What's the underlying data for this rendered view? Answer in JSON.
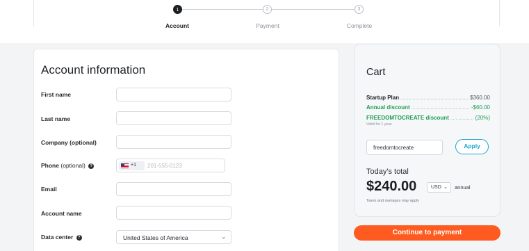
{
  "stepper": {
    "steps": [
      {
        "number": "1",
        "label": "Account",
        "state": "active"
      },
      {
        "number": "2",
        "label": "Payment",
        "state": "inactive"
      },
      {
        "number": "3",
        "label": "Complete",
        "state": "inactive"
      }
    ]
  },
  "form": {
    "title": "Account information",
    "fields": {
      "first_name": {
        "label": "First name",
        "value": ""
      },
      "last_name": {
        "label": "Last name",
        "value": ""
      },
      "company": {
        "label": "Company (optional)",
        "value": ""
      },
      "phone": {
        "label": "Phone",
        "optional": "(optional)",
        "country_code": "+1",
        "placeholder": "201-555-0123",
        "flag": "us-flag-icon"
      },
      "email": {
        "label": "Email",
        "value": ""
      },
      "account_name": {
        "label": "Account name",
        "value": ""
      },
      "data_center": {
        "label": "Data center",
        "value": "United States of America"
      }
    }
  },
  "cart": {
    "title": "Cart",
    "lines": [
      {
        "name": "Startup Plan",
        "amount": "$360.00",
        "kind": "plan"
      },
      {
        "name": "Annual discount",
        "amount": "-$60.00",
        "kind": "discount"
      },
      {
        "name": "FREEDOMTOCREATE discount",
        "amount": "(20%)",
        "kind": "discount"
      }
    ],
    "valid_note": "Valid for 1 year",
    "promo_code": "freedomtocreate",
    "apply_label": "Apply",
    "today_label": "Today's total",
    "total": "$240.00",
    "currency": "USD",
    "period": "annual",
    "tax_note": "Taxes and overages may apply"
  },
  "continue_label": "Continue to payment",
  "colors": {
    "accent_orange": "#ff5a1f",
    "discount_green": "#1f9d55",
    "apply_teal": "#1aa6c9"
  }
}
